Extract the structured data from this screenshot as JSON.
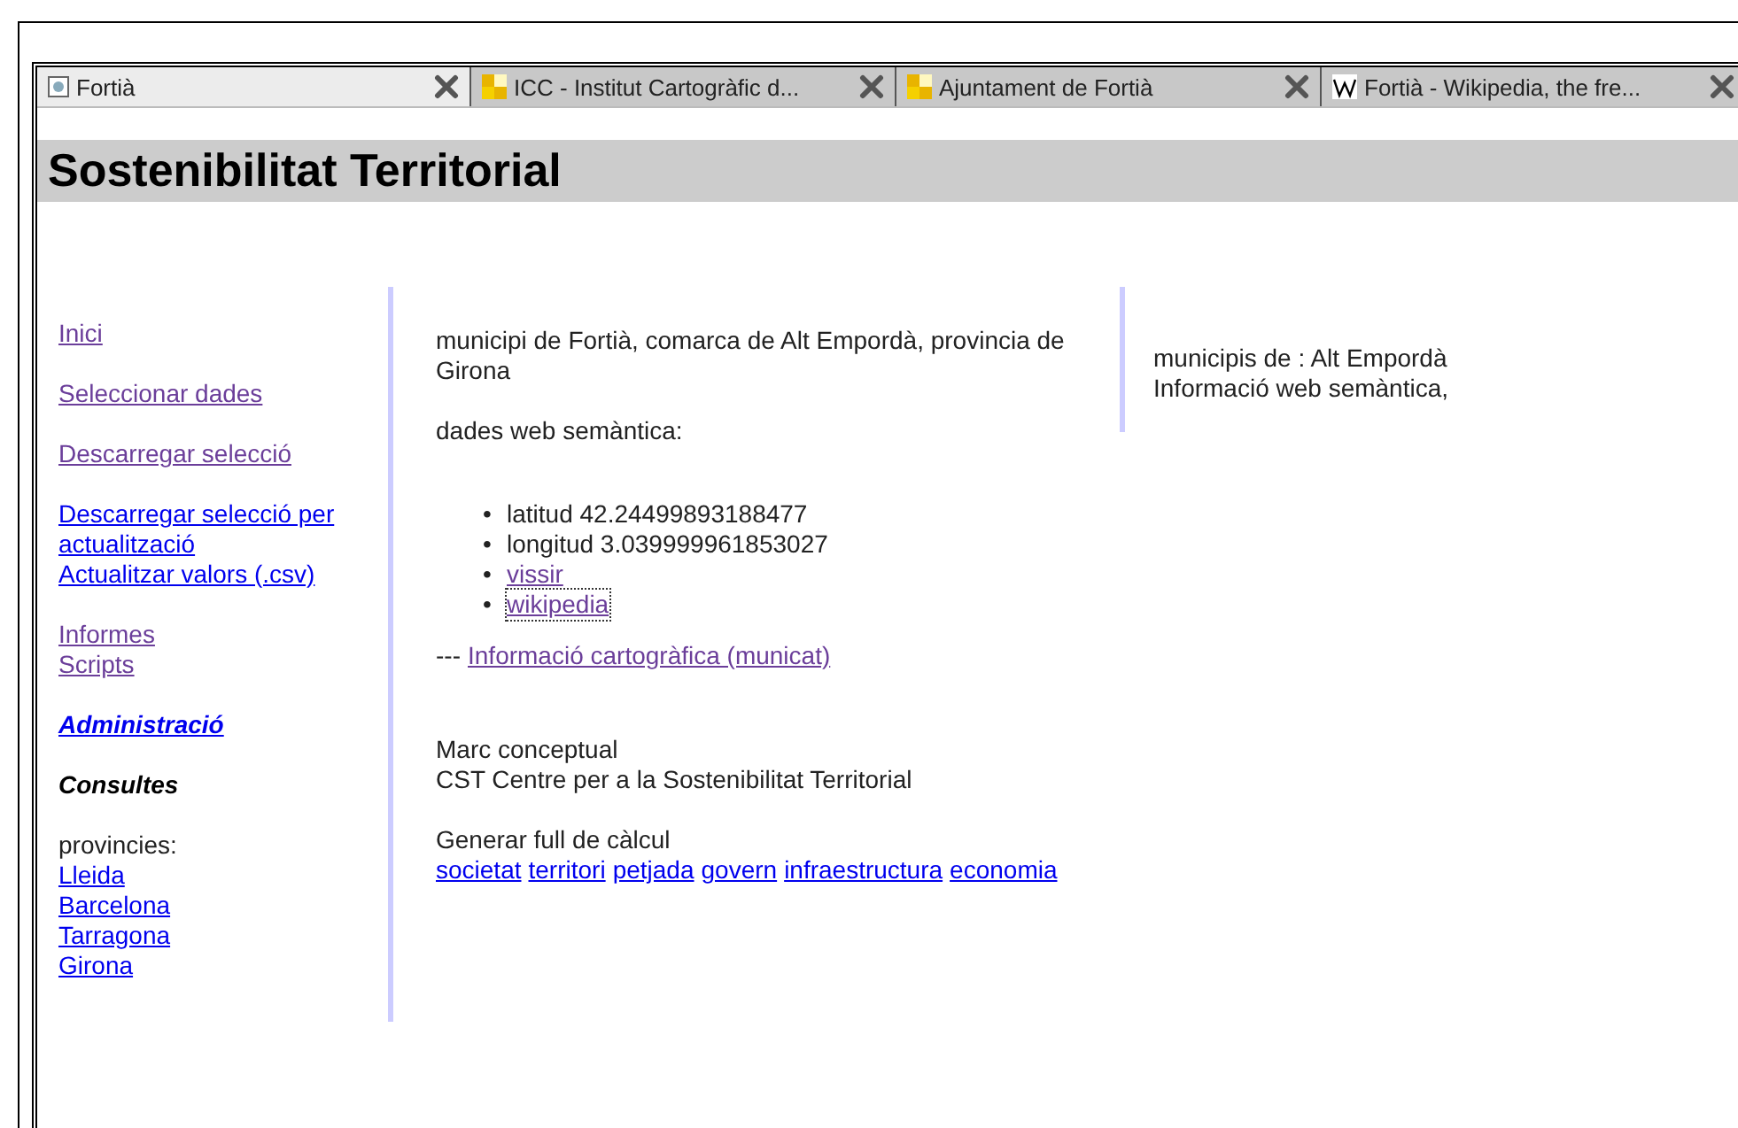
{
  "tabs": [
    {
      "title": "Fortià",
      "kind": "page",
      "selected": true
    },
    {
      "title": "ICC - Institut Cartogràfic d...",
      "kind": "squares",
      "selected": false
    },
    {
      "title": "Ajuntament de Fortià",
      "kind": "squares",
      "selected": false
    },
    {
      "title": "Fortià - Wikipedia, the fre...",
      "kind": "wiki",
      "selected": false
    }
  ],
  "heading": "Sostenibilitat Territorial",
  "sidebar": {
    "groups": [
      [
        {
          "label": "Inici",
          "kind": "link",
          "visited": true
        }
      ],
      [
        {
          "label": "Seleccionar dades",
          "kind": "link",
          "visited": true
        }
      ],
      [
        {
          "label": "Descarregar selecció",
          "kind": "link",
          "visited": true
        }
      ],
      [
        {
          "label": "Descarregar selecció per actualització",
          "kind": "link",
          "visited": false
        },
        {
          "label": "Actualitzar valors (.csv)",
          "kind": "link",
          "visited": false
        }
      ],
      [
        {
          "label": "Informes",
          "kind": "link",
          "visited": true
        },
        {
          "label": "Scripts",
          "kind": "link",
          "visited": true
        }
      ],
      [
        {
          "label": "Administració",
          "kind": "strong-link",
          "visited": false
        }
      ],
      [
        {
          "label": "Consultes",
          "kind": "heading"
        }
      ],
      [
        {
          "label": "provincies:",
          "kind": "text"
        },
        {
          "label": "Lleida",
          "kind": "link",
          "visited": false
        },
        {
          "label": "Barcelona",
          "kind": "link",
          "visited": false
        },
        {
          "label": "Tarragona",
          "kind": "link",
          "visited": false
        },
        {
          "label": "Girona",
          "kind": "link",
          "visited": false
        }
      ]
    ]
  },
  "main": {
    "intro": "municipi de Fortià, comarca de Alt Empordà, provincia de Girona",
    "semantic_label": "dades web semàntica:",
    "bullets": [
      {
        "marker": "•",
        "label": "latitud 42.24499893188477",
        "kind": "text"
      },
      {
        "marker": "•",
        "label": "longitud 3.039999961853027",
        "kind": "text"
      },
      {
        "marker": "•",
        "label": "vissir",
        "kind": "link",
        "visited": true,
        "focused": false
      },
      {
        "marker": "•",
        "label": "wikipedia",
        "kind": "link",
        "visited": true,
        "focused": true
      }
    ],
    "carto_prefix": "---",
    "carto_link": {
      "label": "Informació cartogràfica (municat)",
      "visited": true
    },
    "marc_lines": [
      "Marc conceptual",
      "CST Centre per a la Sostenibilitat Territorial"
    ],
    "sheet_label": "Generar full de càlcul",
    "sheet_links": [
      {
        "label": "societat",
        "visited": false
      },
      {
        "label": "territori",
        "visited": false
      },
      {
        "label": "petjada",
        "visited": false
      },
      {
        "label": "govern",
        "visited": false
      },
      {
        "label": "infraestructura",
        "visited": false
      },
      {
        "label": "economia",
        "visited": false
      }
    ]
  },
  "right": {
    "lines": [
      "municipis de : Alt Empordà",
      "Informació web semàntica,"
    ]
  }
}
